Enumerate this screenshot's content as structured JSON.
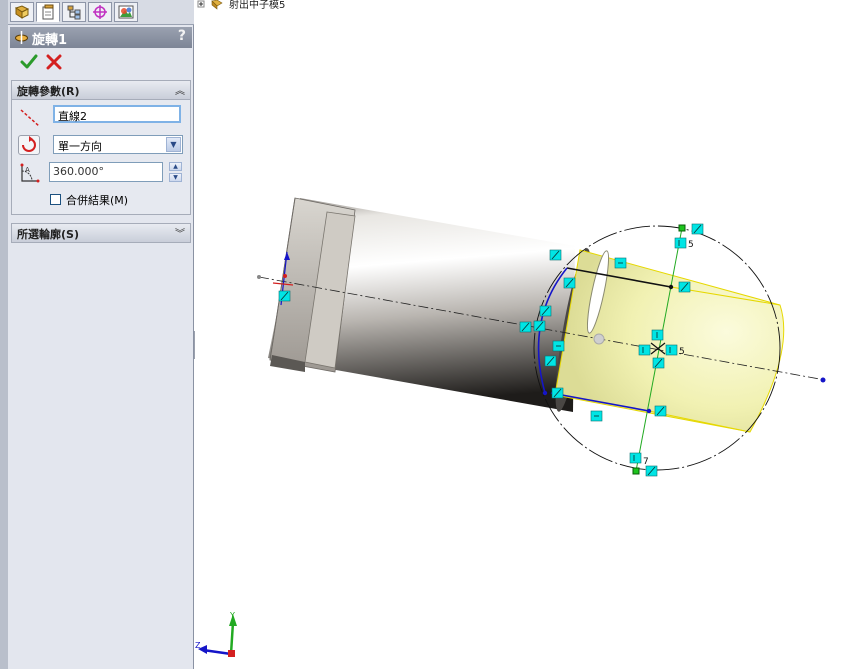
{
  "feature": {
    "title": "旋轉1",
    "help": "?"
  },
  "tabs": [
    {
      "name": "feature-manager",
      "icon": "feature-tree-icon"
    },
    {
      "name": "property-manager",
      "icon": "property-manager-icon",
      "active": true
    },
    {
      "name": "configuration-manager",
      "icon": "configuration-icon"
    },
    {
      "name": "dimxpert-manager",
      "icon": "target-icon"
    },
    {
      "name": "display-manager",
      "icon": "appearance-icon"
    }
  ],
  "actions": {
    "ok_icon": "checkmark-icon",
    "cancel_icon": "close-icon"
  },
  "params_group": {
    "title": "旋轉參數(R)",
    "axis_value": "直線2",
    "direction": {
      "selected": "單一方向"
    },
    "angle": "360.000°",
    "merge_result": {
      "label": "合併結果(M)",
      "checked": false
    }
  },
  "contours_group": {
    "title": "所選輪廓(S)"
  },
  "tree": {
    "node_label": "射出中子模5"
  },
  "viewport": {
    "dimension_marks": [
      "5",
      "5",
      "7"
    ],
    "triad": {
      "y": "Y",
      "z": "Z"
    },
    "colors": {
      "relation_tag": "#00e5e5",
      "sketch_line": "#1515c8",
      "axis_line": "#22aa22",
      "preview_fill": "#f5f5b8"
    }
  }
}
